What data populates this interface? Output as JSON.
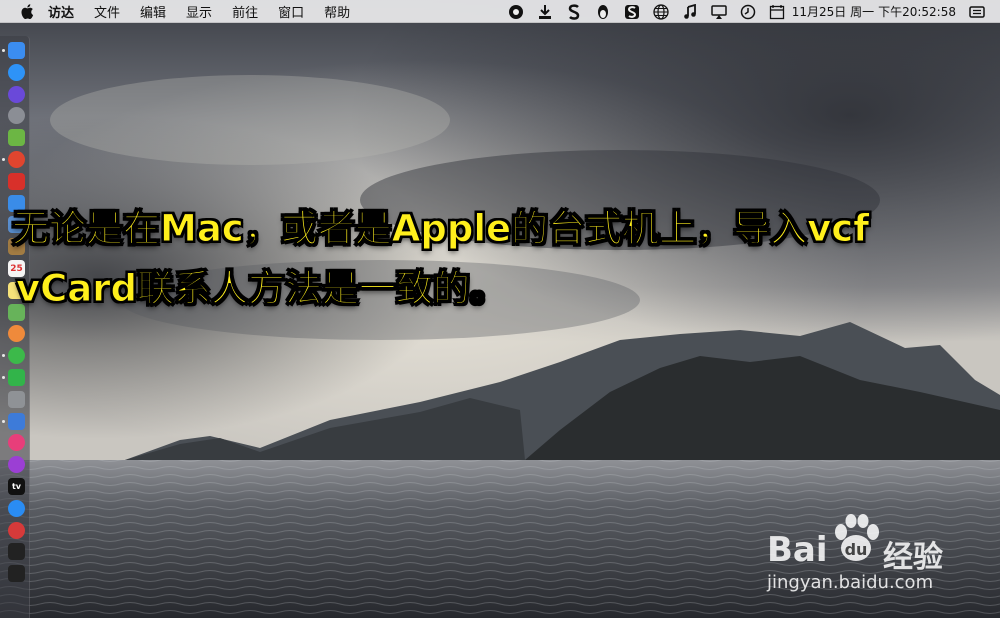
{
  "menubar": {
    "app_name": "访达",
    "items": [
      "文件",
      "编辑",
      "显示",
      "前往",
      "窗口",
      "帮助"
    ],
    "status_icons": [
      "screen-record-icon",
      "download-icon",
      "s-app-icon",
      "qq-penguin-icon",
      "sogou-s-icon",
      "globe-icon",
      "music-note-icon",
      "airplay-display-icon",
      "clock-icon",
      "calendar-icon"
    ],
    "date": "11月25日 周一",
    "time": "下午20:52:58"
  },
  "dock": {
    "icons": [
      {
        "name": "finder-icon",
        "color": "#3b8df0"
      },
      {
        "name": "safari-icon",
        "color": "#2e93f7"
      },
      {
        "name": "siri-icon",
        "color": "#6a49d9"
      },
      {
        "name": "launchpad-rocket-icon",
        "color": "#8b8e95"
      },
      {
        "name": "android-icon",
        "color": "#6cb644"
      },
      {
        "name": "chrome-icon",
        "color": "#e0452f"
      },
      {
        "name": "red-app-icon",
        "color": "#d8302a"
      },
      {
        "name": "mail-icon",
        "color": "#3a8ce8"
      },
      {
        "name": "preview-icon",
        "color": "#5a8fd0"
      },
      {
        "name": "notes-brown-icon",
        "color": "#a37c43"
      },
      {
        "name": "calendar-icon",
        "color": "#f5f5f5"
      },
      {
        "name": "notes-icon",
        "color": "#f6e27a"
      },
      {
        "name": "maps-icon",
        "color": "#67b35a"
      },
      {
        "name": "photos-icon",
        "color": "#ef8a3b"
      },
      {
        "name": "messages-icon",
        "color": "#3cb94a"
      },
      {
        "name": "wechat-icon",
        "color": "#32b44a"
      },
      {
        "name": "system-preferences-icon",
        "color": "#8f9296"
      },
      {
        "name": "keynote-icon",
        "color": "#3d7bd9"
      },
      {
        "name": "itunes-icon",
        "color": "#e83e7a"
      },
      {
        "name": "podcasts-icon",
        "color": "#9b3fd4"
      },
      {
        "name": "apple-tv-icon",
        "color": "#111111"
      },
      {
        "name": "app-store-icon",
        "color": "#2a8cf3"
      },
      {
        "name": "vivaldi-icon",
        "color": "#d63a3a"
      },
      {
        "name": "terminal-icon",
        "color": "#222222"
      },
      {
        "name": "activity-monitor-icon",
        "color": "#222222"
      }
    ],
    "calendar_day": "25",
    "tv_label": "tv"
  },
  "caption": {
    "line1": "无论是在Mac，或者是Apple的台式机上，导入vcf",
    "line2": "vCard联系人方法是一致的。"
  },
  "watermark": {
    "brand_left": "Bai",
    "brand_right": "经验",
    "url": "jingyan.baidu.com"
  }
}
